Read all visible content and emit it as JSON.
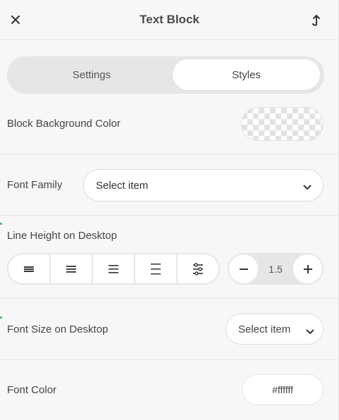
{
  "header": {
    "title": "Text Block",
    "close_icon": "close-icon",
    "pin_icon": "pin-icon"
  },
  "tabs": [
    {
      "label": "Settings",
      "active": false
    },
    {
      "label": "Styles",
      "active": true
    }
  ],
  "block_background": {
    "label": "Block Background Color",
    "value": "transparent"
  },
  "font_family": {
    "label": "Font Family",
    "value": "Select item"
  },
  "line_height": {
    "label": "Line Height on Desktop",
    "options": [
      "align-justify-icon",
      "align-justify-icon",
      "align-left-icon",
      "align-right-icon",
      "sliders-icon"
    ],
    "value": "1.5"
  },
  "font_size": {
    "label": "Font Size on Desktop",
    "value": "Select item"
  },
  "font_color": {
    "label": "Font Color",
    "value": "#ffffff"
  },
  "colors": {
    "accent_dot": "#2fb344"
  }
}
